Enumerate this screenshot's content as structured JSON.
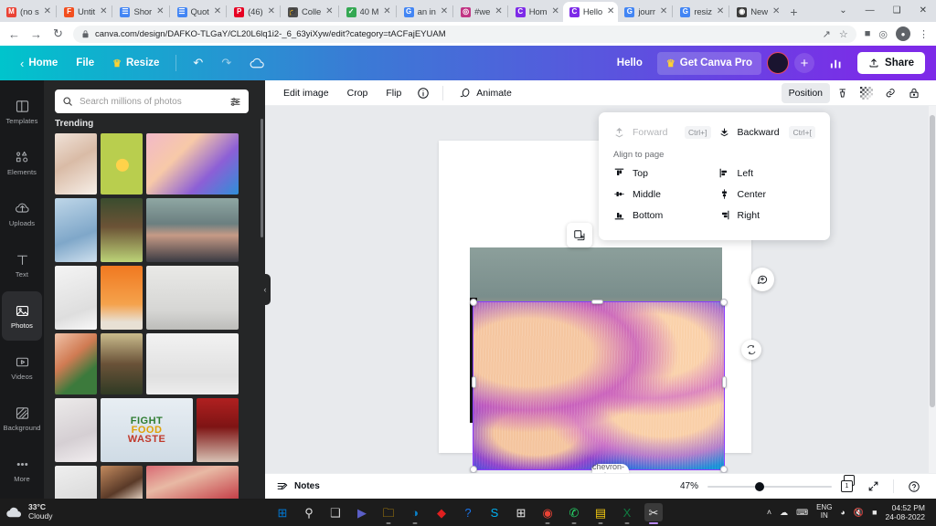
{
  "browser": {
    "tabs": [
      {
        "title": "(no s",
        "favicon": "gmail-icon",
        "color": "#ea4335",
        "glyph": "M",
        "active": false
      },
      {
        "title": "Untit",
        "favicon": "figma-icon",
        "color": "#f24e1e",
        "glyph": "F",
        "active": false
      },
      {
        "title": "Shor",
        "favicon": "docs-icon",
        "color": "#4285f4",
        "glyph": "☰",
        "active": false
      },
      {
        "title": "Quot",
        "favicon": "docs-icon",
        "color": "#4285f4",
        "glyph": "☰",
        "active": false
      },
      {
        "title": "(46)",
        "favicon": "pinterest-icon",
        "color": "#e60023",
        "glyph": "P",
        "active": false
      },
      {
        "title": "Colle",
        "favicon": "scholar-icon",
        "color": "#4d4d4d",
        "glyph": "🎓",
        "active": false
      },
      {
        "title": "40 M",
        "favicon": "check-icon",
        "color": "#34a853",
        "glyph": "✓",
        "active": false
      },
      {
        "title": "an in",
        "favicon": "google-icon",
        "color": "#4285f4",
        "glyph": "G",
        "active": false
      },
      {
        "title": "#we",
        "favicon": "instagram-icon",
        "color": "#c13584",
        "glyph": "◎",
        "active": false
      },
      {
        "title": "Hom",
        "favicon": "canva-icon",
        "color": "#7d2ae8",
        "glyph": "C",
        "active": false
      },
      {
        "title": "Hello",
        "favicon": "canva-icon",
        "color": "#7d2ae8",
        "glyph": "C",
        "active": true
      },
      {
        "title": "jourr",
        "favicon": "google-icon",
        "color": "#4285f4",
        "glyph": "G",
        "active": false
      },
      {
        "title": "resiz",
        "favicon": "google-icon",
        "color": "#4285f4",
        "glyph": "G",
        "active": false
      },
      {
        "title": "New",
        "favicon": "brave-icon",
        "color": "#3b3b3b",
        "glyph": "◉",
        "active": false
      }
    ],
    "new_tab_label": "+",
    "window_controls": [
      "⌄",
      "—",
      "❑",
      "✕"
    ],
    "nav": {
      "back": "←",
      "forward": "→",
      "reload": "↻"
    },
    "omnibox": {
      "lock_icon": "lock-icon",
      "url": "canva.com/design/DAFKO-TLGaY/CL20L6lq1i2-_6_63yiXyw/edit?category=tACFajEYUAM",
      "share_icon": "share-icon",
      "star_icon": "star-icon"
    },
    "toolbar_icons": [
      "puzzle-icon",
      "extension-icon",
      "profile-icon",
      "menu-icon"
    ]
  },
  "canva_header": {
    "back_icon": "chevron-left-icon",
    "home_label": "Home",
    "file_label": "File",
    "resize_label": "Resize",
    "resize_crown": "crown-icon",
    "undo_icon": "undo-icon",
    "redo_icon": "redo-icon",
    "cloud_icon": "cloud-saved-icon",
    "greeting": "Hello",
    "pro_label": "Get Canva Pro",
    "plus_label": "+",
    "stats_icon": "insights-icon",
    "share_label": "Share",
    "share_icon": "upload-icon"
  },
  "rail": {
    "items": [
      {
        "label": "Templates",
        "icon": "templates-icon",
        "active": false
      },
      {
        "label": "Elements",
        "icon": "elements-icon",
        "active": false
      },
      {
        "label": "Uploads",
        "icon": "uploads-icon",
        "active": false
      },
      {
        "label": "Text",
        "icon": "text-icon",
        "active": false
      },
      {
        "label": "Photos",
        "icon": "photos-icon",
        "active": true
      },
      {
        "label": "Videos",
        "icon": "videos-icon",
        "active": false
      },
      {
        "label": "Background",
        "icon": "background-icon",
        "active": false
      },
      {
        "label": "More",
        "icon": "more-icon",
        "active": false
      }
    ]
  },
  "photos_panel": {
    "search_placeholder": "Search millions of photos",
    "search_value": "",
    "search_icon": "search-icon",
    "filter_icon": "sliders-icon",
    "heading": "Trending",
    "thumbnails": [
      {
        "name": "hands-photo",
        "w": "sm",
        "h": 67,
        "css": "linear-gradient(150deg,#f0e2d8,#d9bba6 45%,#f7efe8)"
      },
      {
        "name": "fruit-green-photo",
        "w": "sm",
        "h": 67,
        "css": "radial-gradient(circle at 52% 52%, #ffd24a 0 16%, #b9ce4e 17%)"
      },
      {
        "name": "mushroom-photo",
        "w": "wide",
        "h": 67,
        "css": "linear-gradient(135deg,#f2b9c8,#f7c9a8 35%,#8c5fd6 68%,#2e8fd8)"
      },
      {
        "name": "denim-photo",
        "w": "sm",
        "h": 70,
        "css": "linear-gradient(160deg,#bed6e8,#7fa7c9 60%,#cfe0ee)"
      },
      {
        "name": "cafe-photo",
        "w": "sm",
        "h": 70,
        "css": "linear-gradient(180deg,#3a4c2e,#6c5336 45%,#bcd377)"
      },
      {
        "name": "three-friends-photo",
        "w": "wide",
        "h": 70,
        "css": "linear-gradient(180deg,#8fa7a3,#6b7f80 40%,#c69a86 58%,#3a3a42)"
      },
      {
        "name": "white-shoes-photo",
        "w": "sm",
        "h": 70,
        "css": "linear-gradient(160deg,#f4f4f4,#dedede 70%,#f9f9f9)"
      },
      {
        "name": "orange-still-photo",
        "w": "sm",
        "h": 70,
        "css": "linear-gradient(180deg,#f07820,#f5a24c 60%,#e8e0d4 88%)"
      },
      {
        "name": "dancers-photo",
        "w": "wide",
        "h": 70,
        "css": "linear-gradient(180deg,#e9e9e7,#d6d6d4 70%,#bdbdba)"
      },
      {
        "name": "child-frame-photo",
        "w": "sm",
        "h": 67,
        "css": "linear-gradient(140deg,#f0c2a8,#d07b53 40%,#3c7a3c 70%)"
      },
      {
        "name": "restaurant-photo",
        "w": "sm",
        "h": 67,
        "css": "linear-gradient(180deg,#c9bb8c,#6a5238 50%,#2f3a24)"
      },
      {
        "name": "boombox-photo",
        "w": "wide",
        "h": 67,
        "css": "linear-gradient(180deg,#f2f2f2,#e0e0e0 70%,#ededed)"
      },
      {
        "name": "dancing-woman-photo",
        "w": "sm",
        "h": 70,
        "css": "linear-gradient(160deg,#eceaea,#d5cfd3 60%,#f2eef0)"
      },
      {
        "name": "fight-food-waste-photo",
        "w": "wide",
        "h": 70,
        "css": "linear-gradient(180deg,#e8eef3,#cfdbe5)"
      },
      {
        "name": "group-red-photo",
        "w": "sm",
        "h": 70,
        "css": "linear-gradient(180deg,#b02020,#7e1414 45%,#d8c2b4)"
      },
      {
        "name": "gray-photo",
        "w": "sm",
        "h": 38,
        "css": "linear-gradient(160deg,#efefef,#d9d9d9)"
      },
      {
        "name": "profile-photo",
        "w": "sm",
        "h": 38,
        "css": "linear-gradient(150deg,#c38a5e,#5a3a28 60%,#e8d6c6)"
      },
      {
        "name": "two-women-photo",
        "w": "wide",
        "h": 38,
        "css": "linear-gradient(160deg,#d96b74,#e8b9a4 40%,#c33a44)"
      }
    ],
    "collapse_icon": "chevron-left-icon"
  },
  "editor_toolbar": {
    "edit_image": "Edit image",
    "crop": "Crop",
    "flip": "Flip",
    "info_icon": "info-icon",
    "animate_icon": "animate-icon",
    "animate": "Animate",
    "position": "Position",
    "transparency_icon": "transparency-icon",
    "checker_icon": "checkerboard-icon",
    "link_icon": "link-icon",
    "lock_icon": "lock-icon"
  },
  "position_panel": {
    "forward_label": "Forward",
    "forward_shortcut": "Ctrl+]",
    "forward_icon": "bring-forward-icon",
    "backward_label": "Backward",
    "backward_shortcut": "Ctrl+[",
    "backward_icon": "send-backward-icon",
    "section_label": "Align to page",
    "align_items": [
      {
        "label": "Top",
        "icon": "align-top-icon"
      },
      {
        "label": "Left",
        "icon": "align-left-icon"
      },
      {
        "label": "Middle",
        "icon": "align-middle-icon"
      },
      {
        "label": "Center",
        "icon": "align-center-icon"
      },
      {
        "label": "Bottom",
        "icon": "align-bottom-icon"
      },
      {
        "label": "Right",
        "icon": "align-right-icon"
      }
    ]
  },
  "canvas": {
    "duplicate_icon": "duplicate-icon",
    "comment_icon": "add-comment-icon",
    "rotate_icon": "rotate-icon",
    "selected_image_name": "mushroom-image-selected"
  },
  "bottom_bar": {
    "notes_label": "Notes",
    "notes_icon": "notes-icon",
    "zoom_level": "47%",
    "page_count": "1",
    "fullscreen_icon": "expand-icon",
    "help_icon": "help-icon",
    "expand_icon": "chevron-up-icon"
  },
  "taskbar": {
    "weather_temp": "33°C",
    "weather_desc": "Cloudy",
    "weather_icon": "cloud-icon",
    "apps": [
      {
        "name": "start-button",
        "glyph": "⊞",
        "color": "#0078d4",
        "active": false,
        "dot": false
      },
      {
        "name": "search-icon",
        "glyph": "⚲",
        "color": "#e0e0e0",
        "active": false,
        "dot": false
      },
      {
        "name": "task-view-icon",
        "glyph": "❑",
        "color": "#d0d0d0",
        "active": false,
        "dot": false
      },
      {
        "name": "teams-icon",
        "glyph": "▶",
        "color": "#5b5fc7",
        "active": false,
        "dot": false
      },
      {
        "name": "file-explorer-icon",
        "glyph": "🗀",
        "color": "#ffb900",
        "active": false,
        "dot": true
      },
      {
        "name": "edge-icon",
        "glyph": "◑",
        "color": "#0a81c9",
        "active": false,
        "dot": true
      },
      {
        "name": "acrobat-icon",
        "glyph": "◆",
        "color": "#e02020",
        "active": false,
        "dot": false
      },
      {
        "name": "quiz-icon",
        "glyph": "?",
        "color": "#1a73e8",
        "active": false,
        "dot": false
      },
      {
        "name": "skype-icon",
        "glyph": "S",
        "color": "#00aff0",
        "active": false,
        "dot": false
      },
      {
        "name": "store-icon",
        "glyph": "⊞",
        "color": "#e8e8e8",
        "active": false,
        "dot": false
      },
      {
        "name": "chrome-icon",
        "glyph": "◉",
        "color": "#ea4335",
        "active": false,
        "dot": true
      },
      {
        "name": "whatsapp-icon",
        "glyph": "✆",
        "color": "#25d366",
        "active": false,
        "dot": true
      },
      {
        "name": "powerbi-icon",
        "glyph": "▤",
        "color": "#f2c811",
        "active": false,
        "dot": true
      },
      {
        "name": "excel-icon",
        "glyph": "X",
        "color": "#107c41",
        "active": false,
        "dot": true
      },
      {
        "name": "snipping-tool-icon",
        "glyph": "✂",
        "color": "#e6e6e6",
        "active": true,
        "dot": true
      }
    ],
    "tray": {
      "chevron": "˄",
      "onedrive_icon": "onedrive-icon",
      "keyboard_icon": "keyboard-icon",
      "lang_top": "ENG",
      "lang_bottom": "IN",
      "wifi_icon": "wifi-icon",
      "mute_icon": "volume-mute-icon",
      "battery_icon": "battery-icon",
      "time": "04:52 PM",
      "date": "24-08-2022"
    }
  },
  "colors": {
    "canva_purple": "#7d2ae8",
    "canva_teal": "#00c4cc",
    "selection": "#8b3dff",
    "taskbar_bg": "#1c1c1c"
  }
}
